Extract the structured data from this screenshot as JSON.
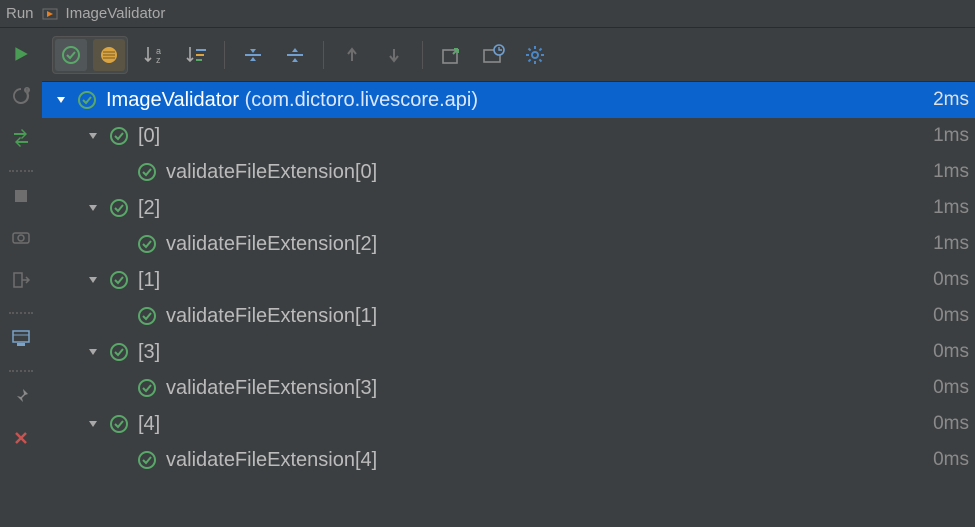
{
  "header": {
    "run_label": "Run",
    "config_name": "ImageValidator"
  },
  "tree": {
    "root": {
      "name": "ImageValidator",
      "package": "(com.dictoro.livescore.api)",
      "time": "2ms"
    },
    "groups": [
      {
        "label": "[0]",
        "time": "1ms",
        "child_label": "validateFileExtension[0]",
        "child_time": "1ms"
      },
      {
        "label": "[2]",
        "time": "1ms",
        "child_label": "validateFileExtension[2]",
        "child_time": "1ms"
      },
      {
        "label": "[1]",
        "time": "0ms",
        "child_label": "validateFileExtension[1]",
        "child_time": "0ms"
      },
      {
        "label": "[3]",
        "time": "0ms",
        "child_label": "validateFileExtension[3]",
        "child_time": "0ms"
      },
      {
        "label": "[4]",
        "time": "0ms",
        "child_label": "validateFileExtension[4]",
        "child_time": "0ms"
      }
    ]
  }
}
